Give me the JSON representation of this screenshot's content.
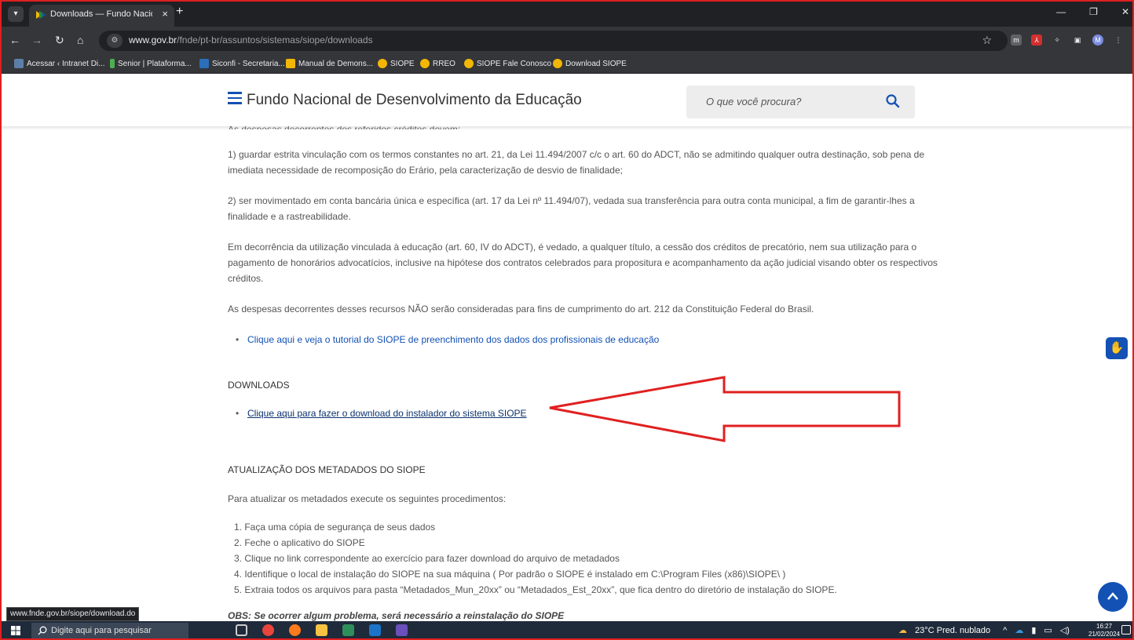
{
  "browser": {
    "tab_title": "Downloads — Fundo Nacional",
    "new_tab_symbol": "+",
    "url_host": "www.gov.br",
    "url_path": "/fnde/pt-br/assuntos/sistemas/siope/downloads",
    "bookmarks": [
      {
        "label": "Acessar ‹ Intranet Di...",
        "color": "#5b7fa8"
      },
      {
        "label": "Senior | Plataforma...",
        "color": "#4caf50"
      },
      {
        "label": "Siconfi - Secretaria...",
        "color": "#2a6fb8"
      },
      {
        "label": "Manual de Demons...",
        "color": "#f2b705"
      },
      {
        "label": "SIOPE",
        "color": "#f2b705"
      },
      {
        "label": "RREO",
        "color": "#f2b705"
      },
      {
        "label": "SIOPE Fale Conosco",
        "color": "#f2b705"
      },
      {
        "label": "Download SIOPE",
        "color": "#f2b705"
      }
    ],
    "status_url": "www.fnde.gov.br/siope/download.do"
  },
  "header": {
    "title": "Fundo Nacional de Desenvolvimento da Educação",
    "search_placeholder": "O que você procura?"
  },
  "content": {
    "cut_text": "As despesas decorrentes dos referidos créditos devem:",
    "p1": "1) guardar estrita vinculação com os termos constantes no art. 21, da Lei 11.494/2007 c/c o art. 60 do ADCT, não se admitindo qualquer outra destinação, sob pena de imediata necessidade de recomposição do Erário, pela caracterização de desvio de finalidade;",
    "p2": "2) ser movimentado em conta bancária única e específica (art. 17 da Lei nº 11.494/07), vedada sua transferência para outra conta municipal, a fim de garantir-lhes a finalidade e a rastreabilidade.",
    "p3": "Em decorrência da utilização vinculada à educação (art. 60, IV do ADCT), é vedado, a qualquer título, a cessão dos créditos de precatório, nem sua utilização para o pagamento de honorários advocatícios, inclusive na hipótese dos contratos celebrados para propositura e acompanhamento da ação judicial visando obter os respectivos créditos.",
    "p4": "As despesas decorrentes desses recursos NÃO serão consideradas para fins de cumprimento do art. 212 da Constituição Federal do Brasil.",
    "tutorial_link": "Clique aqui e veja o tutorial do SIOPE de preenchimento dos dados dos profissionais de educação",
    "downloads_heading": "DOWNLOADS",
    "download_link": "Clique aqui para fazer o download do instalador do sistema SIOPE",
    "metadata_heading": "ATUALIZAÇÃO DOS METADADOS DO SIOPE",
    "metadata_intro": "Para atualizar os metadados execute os seguintes procedimentos:",
    "steps": [
      "1. Faça uma cópia de segurança de seus dados",
      "2. Feche o aplicativo do SIOPE",
      "3. Clique no link correspondente ao exercício para fazer download do arquivo de metadados",
      "4. Identifique o local de instalação do SIOPE na sua máquina ( Por padrão o SIOPE é instalado em C:\\Program Files (x86)\\SIOPE\\ )",
      "5. Extraia todos os arquivos para pasta “Metadados_Mun_20xx” ou “Metadados_Est_20xx”, que fica dentro do diretório de instalação do SIOPE."
    ],
    "obs": "OBS: Se ocorrer algum problema, será necessário a reinstalação do SIOPE"
  },
  "taskbar": {
    "search_placeholder": "Digite aqui para pesquisar",
    "weather": "23°C  Pred. nublado",
    "time": "16:27",
    "date": "21/02/2024"
  },
  "colors": {
    "accent": "#1351b4",
    "annotation_arrow": "#e02020"
  }
}
